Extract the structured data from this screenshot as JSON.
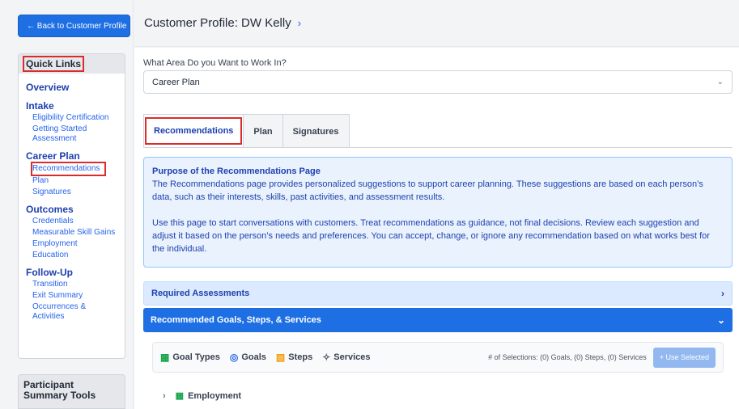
{
  "back_button": "← Back to Customer Profile",
  "quick_links": {
    "title": "Quick Links",
    "sections": [
      {
        "label": "Overview",
        "links": []
      },
      {
        "label": "Intake",
        "links": [
          "Eligibility Certification",
          "Getting Started Assessment"
        ]
      },
      {
        "label": "Career Plan",
        "links": [
          "Recommendations",
          "Plan",
          "Signatures"
        ]
      },
      {
        "label": "Outcomes",
        "links": [
          "Credentials",
          "Measurable Skill Gains",
          "Employment",
          "Education"
        ]
      },
      {
        "label": "Follow-Up",
        "links": [
          "Transition",
          "Exit Summary",
          "Occurrences & Activities"
        ]
      }
    ]
  },
  "participant_tools": "Participant Summary Tools",
  "header": {
    "title": "Customer Profile: DW Kelly",
    "chevron": "›"
  },
  "area": {
    "label": "What Area Do you Want to Work In?",
    "value": "Career Plan",
    "caret": "⌄"
  },
  "tabs": [
    "Recommendations",
    "Plan",
    "Signatures"
  ],
  "info": {
    "title": "Purpose of the Recommendations Page",
    "p1": "The Recommendations page provides personalized suggestions to support career planning. These suggestions are based on each person’s data, such as their interests, skills, past activities, and assessment results.",
    "p2": "Use this page to start conversations with customers. Treat recommendations as guidance, not final decisions. Review each suggestion and adjust it based on the person’s needs and preferences. You can accept, change, or ignore any recommendation based on what works best for the individual."
  },
  "accordions": {
    "required": {
      "label": "Required Assessments",
      "indicator": "›"
    },
    "recommended": {
      "label": "Recommended Goals, Steps, & Services",
      "indicator": "⌄"
    }
  },
  "legend": [
    {
      "icon": "goal-types-icon",
      "glyph": "▦",
      "color": "#16a34a",
      "label": "Goal Types"
    },
    {
      "icon": "goals-icon",
      "glyph": "◎",
      "color": "#2563eb",
      "label": "Goals"
    },
    {
      "icon": "steps-icon",
      "glyph": "▧",
      "color": "#f59e0b",
      "label": "Steps"
    },
    {
      "icon": "services-icon",
      "glyph": "✧",
      "color": "#4b5563",
      "label": "Services"
    }
  ],
  "selection_count": "# of Selections: (0) Goals, (0) Steps, (0) Services",
  "use_selected": "+ Use Selected",
  "tree": {
    "expander": "›",
    "label": "Employment"
  }
}
